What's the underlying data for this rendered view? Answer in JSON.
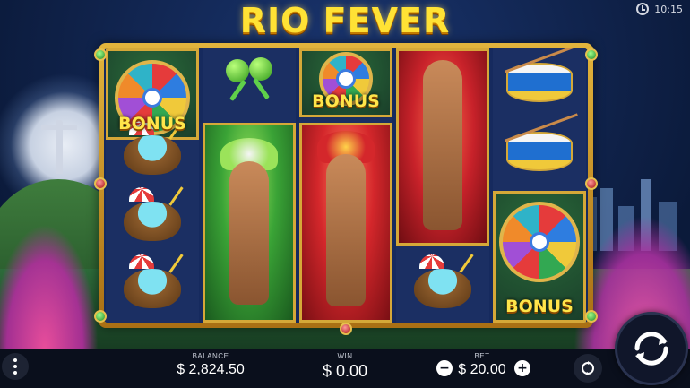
{
  "game": {
    "title": "RIO FEVER"
  },
  "status_bar": {
    "time": "10:15"
  },
  "reels": [
    [
      "bonus",
      "coconut",
      "coconut",
      "coconut"
    ],
    [
      "maracas",
      "dancer-green"
    ],
    [
      "bonus",
      "dancer-red"
    ],
    [
      "dancer-red",
      "coconut"
    ],
    [
      "drum",
      "drum",
      "bonus"
    ]
  ],
  "symbols": {
    "bonus_label": "BONUS"
  },
  "footer": {
    "balance_label": "BALANCE",
    "balance_value": "$ 2,824.50",
    "win_label": "WIN",
    "win_value": "$ 0.00",
    "bet_label": "BET",
    "bet_value": "$ 20.00",
    "bet_decrease": "−",
    "bet_increase": "+"
  },
  "icons": {
    "menu": "menu-dots-icon",
    "autoplay": "autoplay-icon",
    "spin": "spin-icon",
    "clock": "clock-icon"
  },
  "colors": {
    "title": "#ffe235",
    "frame_gold": "#d5a838",
    "reel_bg": "#1b2f63",
    "footer_bg": "#0a0f1c"
  }
}
